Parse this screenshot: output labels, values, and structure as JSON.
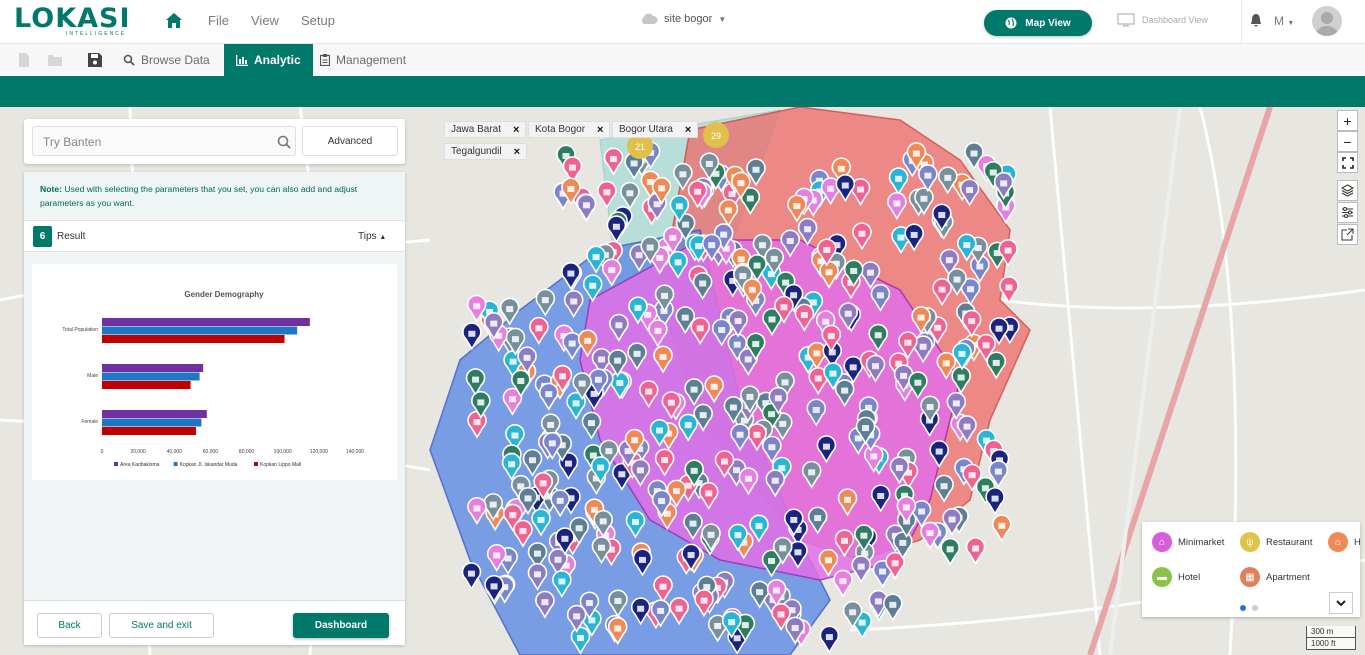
{
  "app": {
    "logo": "LOKASI",
    "logo_sub": "INTELLIGENCE"
  },
  "menu": {
    "file": "File",
    "view": "View",
    "setup": "Setup"
  },
  "site": {
    "label": "site bogor"
  },
  "header": {
    "map_view": "Map View",
    "dashboard_view": "Dashboard View",
    "user_initial": "M"
  },
  "tabs": {
    "browse": "Browse Data",
    "analytic": "Analytic",
    "management": "Management"
  },
  "search": {
    "placeholder": "Try Banten",
    "advanced": "Advanced"
  },
  "note": {
    "label": "Note:",
    "text": " Used with selecting the parameters that you set, you can also add and adjust parameters as you want."
  },
  "result": {
    "count": "6",
    "label": "Result",
    "tips": "Tips"
  },
  "footer": {
    "back": "Back",
    "save_exit": "Save and exit",
    "dashboard": "Dashboard"
  },
  "chips": [
    "Jawa Barat",
    "Kota Bogor",
    "Bogor Utara",
    "Tegalgundil"
  ],
  "clusters": [
    "21",
    "29"
  ],
  "legend": {
    "minimarket": "Minimarket",
    "restaurant": "Restaurant",
    "hotel": "Hotel",
    "apartment": "Apartment",
    "more": "H"
  },
  "scale": {
    "m": "300 m",
    "ft": "1000 ft"
  },
  "colors": {
    "accent": "#00796b",
    "series1": "#7030a0",
    "series2": "#1f77c4",
    "series3": "#c00000"
  },
  "chart_data": {
    "type": "bar",
    "orientation": "horizontal",
    "title": "Gender Demography",
    "categories": [
      "Total Population",
      "Male",
      "Female"
    ],
    "series": [
      {
        "name": "Area Karibakisma",
        "values": [
          115000,
          56000,
          58000
        ]
      },
      {
        "name": "Kopkan Jl. Iskandar Muda",
        "values": [
          108000,
          54000,
          55000
        ]
      },
      {
        "name": "Kopkan Lippo Mall",
        "values": [
          101000,
          49000,
          52000
        ]
      }
    ],
    "xlim": [
      0,
      140000
    ],
    "xticks": [
      "0",
      "20,000",
      "40,000",
      "60,000",
      "80,000",
      "100,000",
      "120,000",
      "140,000"
    ],
    "legend_position": "bottom",
    "grid": false
  }
}
